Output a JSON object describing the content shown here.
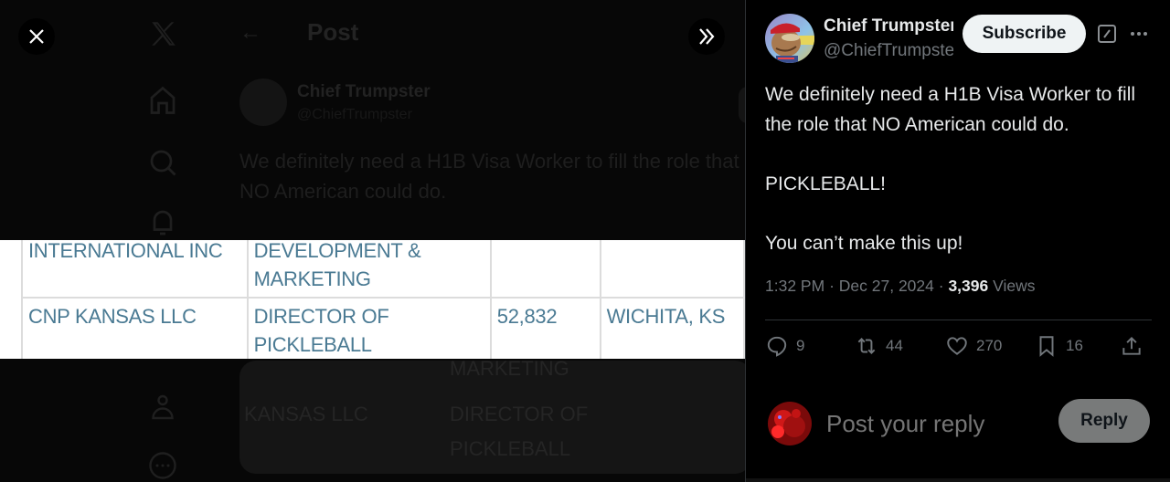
{
  "background_app": {
    "page_title": "Post",
    "author_name": "Chief Trumpster",
    "author_handle": "@ChiefTrumpster",
    "text": "We definitely need a H1B Visa Worker to fill the role that NO American could do.",
    "card_lines": [
      "MARKETING",
      "KANSAS LLC",
      "DIRECTOR OF",
      "PICKLEBALL"
    ]
  },
  "media": {
    "close_label": "Close",
    "expand_label": "Hide panel",
    "table": {
      "rows": [
        {
          "company": "INTERNATIONAL INC",
          "title_line1": "DEVELOPMENT &",
          "title_line2": "MARKETING",
          "salary": "",
          "location": ""
        },
        {
          "company": "CNP KANSAS LLC",
          "title_line1": "DIRECTOR OF",
          "title_line2": "PICKLEBALL",
          "salary": "52,832",
          "location": "WICHITA, KS"
        }
      ]
    }
  },
  "post": {
    "author": {
      "name": "Chief Trumpster",
      "handle": "@ChiefTrumpster"
    },
    "subscribe_label": "Subscribe",
    "text": "We definitely need a H1B Visa Worker to fill the role that NO American could do.\n\nPICKLEBALL!\n\nYou can’t make this up!",
    "time": "1:32 PM",
    "separator": "·",
    "date": "Dec 27, 2024",
    "views_count": "3,396",
    "views_label": "Views",
    "actions": {
      "replies": "9",
      "reposts": "44",
      "likes": "270",
      "bookmarks": "16"
    }
  },
  "reply": {
    "placeholder": "Post your reply",
    "button_label": "Reply"
  },
  "colors": {
    "text_primary": "#e7e9ea",
    "text_secondary": "#71767b",
    "table_text": "#4a7a93",
    "subscribe_bg": "#eff3f4",
    "reply_btn_bg": "#787a7a"
  }
}
